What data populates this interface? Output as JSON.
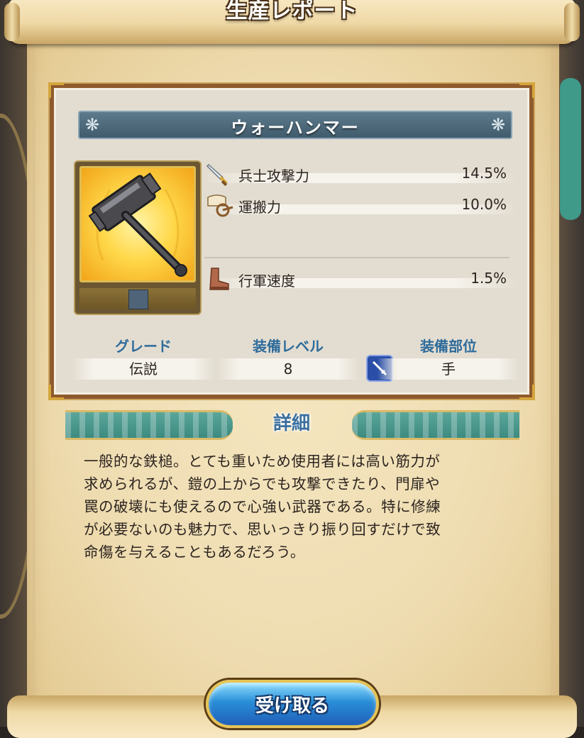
{
  "header": {
    "title": "生産レポート"
  },
  "item": {
    "name": "ウォーハンマー",
    "icon": "war-hammer-icon"
  },
  "stats": [
    {
      "label": "兵士攻撃力",
      "value": "14.5%",
      "icon": "sword-icon"
    },
    {
      "label": "運搬力",
      "value": "10.0%",
      "icon": "cart-icon"
    },
    {
      "label": "行軍速度",
      "value": "1.5%",
      "icon": "boot-icon"
    }
  ],
  "info": {
    "grade_label": "グレード",
    "grade_value": "伝説",
    "level_label": "装備レベル",
    "level_value": "8",
    "slot_label": "装備部位",
    "slot_value": "手",
    "slot_icon": "sword-badge-icon"
  },
  "detail": {
    "label": "詳細",
    "text": "一般的な鉄槌。とても重いため使用者には高い筋力が\n求められるが、鎧の上からでも攻撃できたり、門扉や\n罠の破壊にも使えるので心強い武器である。特に修練\nが必要ないのも魅力で、思いっきり振り回すだけで致\n命傷を与えることもあるだろう。"
  },
  "buttons": {
    "receive": "受け取る"
  },
  "colors": {
    "parchment": "#efddb2",
    "panel_border": "#8f5a2c",
    "name_bar": "#4b6878",
    "info_heading": "#2e6b9a",
    "button": "#2a8ed8"
  }
}
